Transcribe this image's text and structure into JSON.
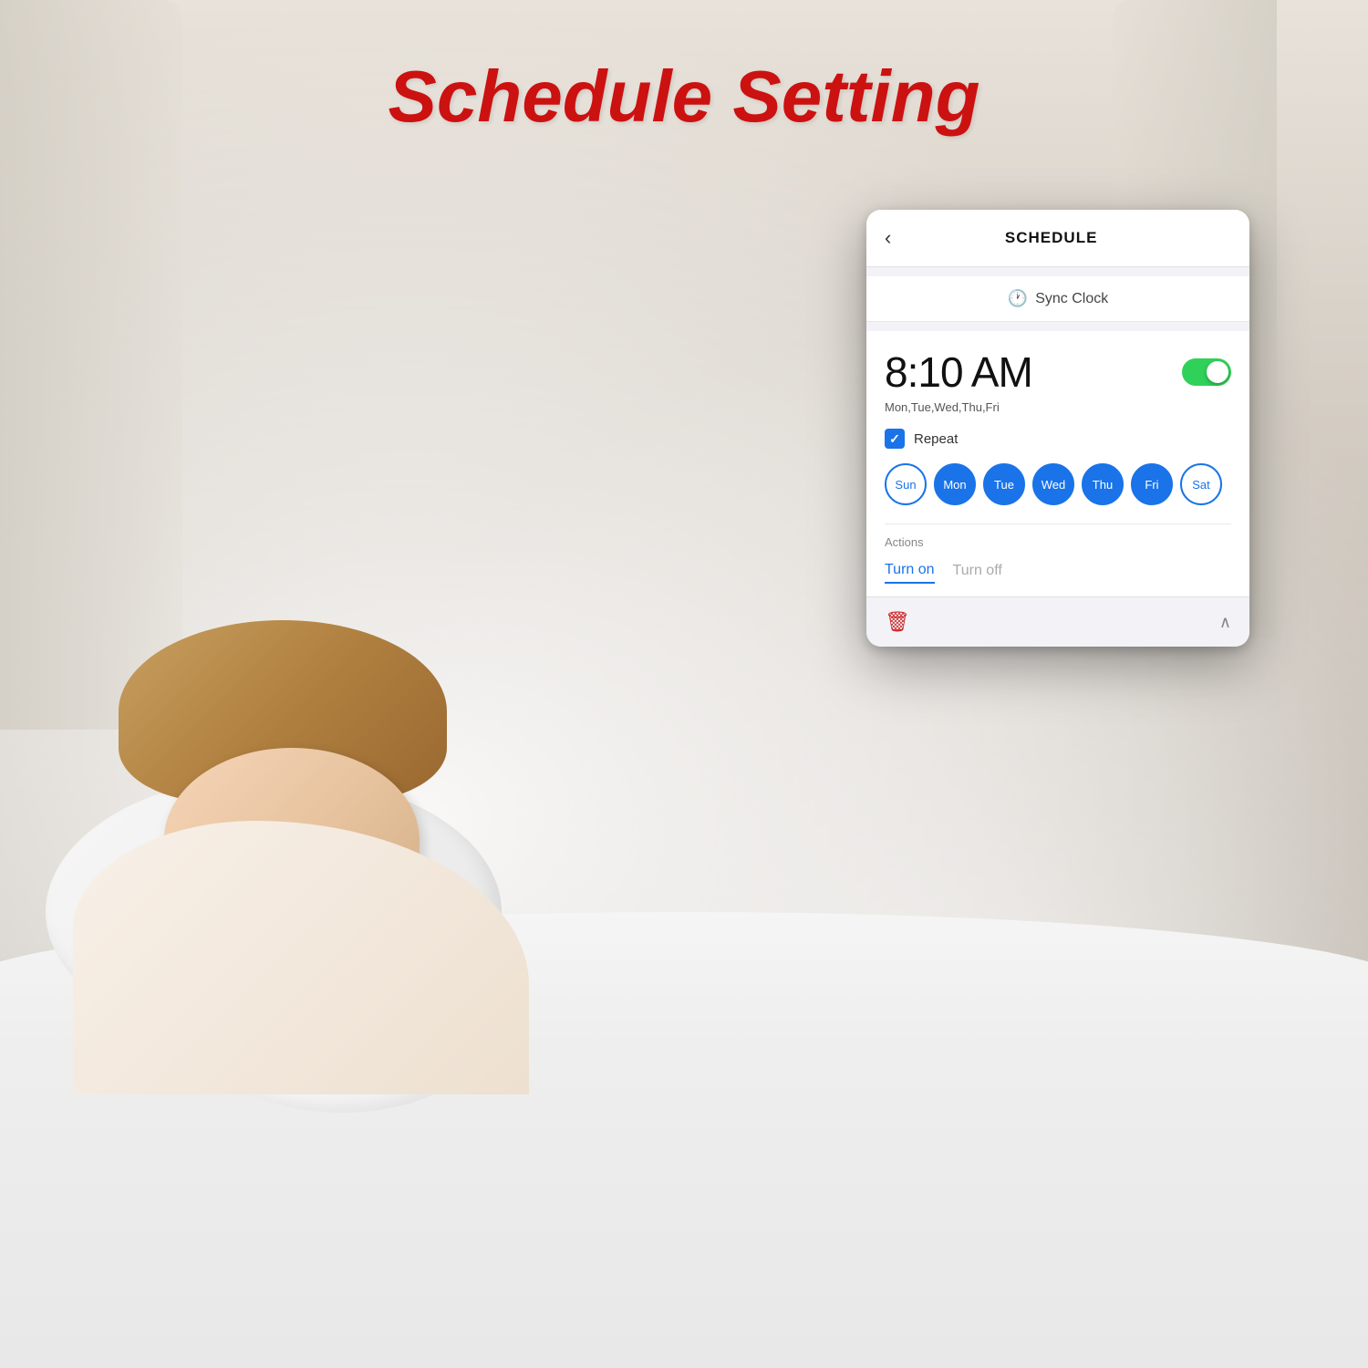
{
  "page": {
    "title": "Schedule Setting",
    "title_color": "#cc1111"
  },
  "header": {
    "back_label": "‹",
    "title": "SCHEDULE"
  },
  "sync_clock": {
    "label": "Sync Clock",
    "icon": "🕐"
  },
  "schedule": {
    "time": "8:10 AM",
    "days_summary": "Mon,Tue,Wed,Thu,Fri",
    "toggle_on": true,
    "repeat_label": "Repeat",
    "repeat_checked": true
  },
  "days": [
    {
      "label": "Sun",
      "selected": false
    },
    {
      "label": "Mon",
      "selected": true
    },
    {
      "label": "Tue",
      "selected": true
    },
    {
      "label": "Wed",
      "selected": true
    },
    {
      "label": "Thu",
      "selected": true
    },
    {
      "label": "Fri",
      "selected": true
    },
    {
      "label": "Sat",
      "selected": false
    }
  ],
  "actions": {
    "label": "Actions",
    "turn_on": "Turn on",
    "turn_off": "Turn off"
  },
  "bottom": {
    "chevron_up": "∧"
  }
}
